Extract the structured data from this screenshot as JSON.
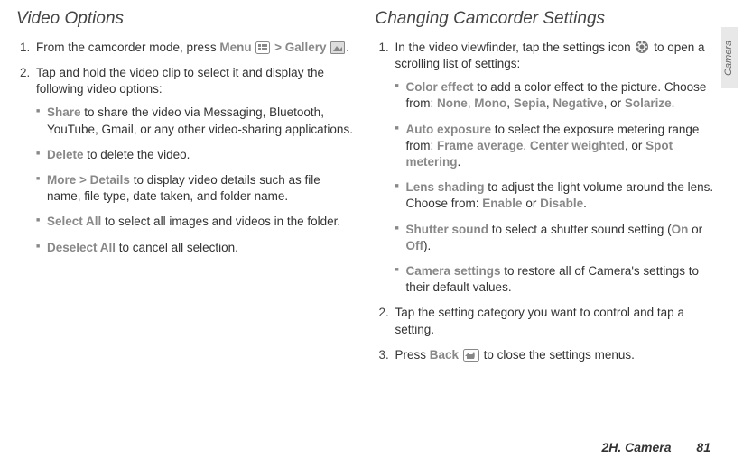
{
  "left": {
    "title": "Video Options",
    "step1_a": "From the camcorder mode, press ",
    "step1_menu": "Menu",
    "step1_gt": " > ",
    "step1_gallery": "Gallery",
    "step1_end": ".",
    "step2": "Tap and hold the video clip to select it and display the following video options:",
    "bullets": {
      "share": {
        "label": "Share",
        "text": " to share the video via Messaging, Bluetooth, YouTube, Gmail, or any other video-sharing applications."
      },
      "delete": {
        "label": "Delete",
        "text": " to delete the video."
      },
      "more": {
        "label1": "More",
        "gt": " > ",
        "label2": "Details",
        "text": " to display video details such as file name, file type, date taken, and folder name."
      },
      "selectall": {
        "label": "Select All",
        "text": " to select all images and videos in the folder."
      },
      "deselectall": {
        "label": "Deselect All",
        "text": " to cancel all selection."
      }
    }
  },
  "right": {
    "title": "Changing Camcorder Settings",
    "step1_a": "In the video viewfinder, tap the settings icon ",
    "step1_b": " to open a scrolling list of settings:",
    "bullets": {
      "color": {
        "label": "Color effect",
        "text1": " to add a color effect to the picture. Choose from: ",
        "opt1": "None",
        "opt2": "Mono",
        "opt3": "Sepia",
        "opt4": "Negative",
        "opt5": "Solarize",
        "or": ", or "
      },
      "auto": {
        "label": "Auto exposure",
        "text1": " to select the exposure metering range from: ",
        "opt1": "Frame average",
        "opt2": "Center weighted",
        "opt3": "Spot metering",
        "or": ", or "
      },
      "lens": {
        "label": "Lens shading",
        "text1": " to adjust the light volume around the lens. Choose from: ",
        "opt1": "Enable",
        "or": " or ",
        "opt2": "Disable"
      },
      "shutter": {
        "label": "Shutter sound",
        "text1": " to select a shutter sound setting (",
        "opt1": "On",
        "or": " or ",
        "opt2": "Off",
        "close": ")."
      },
      "camera": {
        "label": "Camera settings",
        "text1": " to restore all of Camera's settings to their default values."
      }
    },
    "step2": "Tap the setting category you want to control and tap a setting.",
    "step3_a": "Press ",
    "step3_back": "Back",
    "step3_b": " to close the settings menus."
  },
  "footer": {
    "section": "2H. Camera",
    "page": "81"
  },
  "sidetab": "Camera"
}
